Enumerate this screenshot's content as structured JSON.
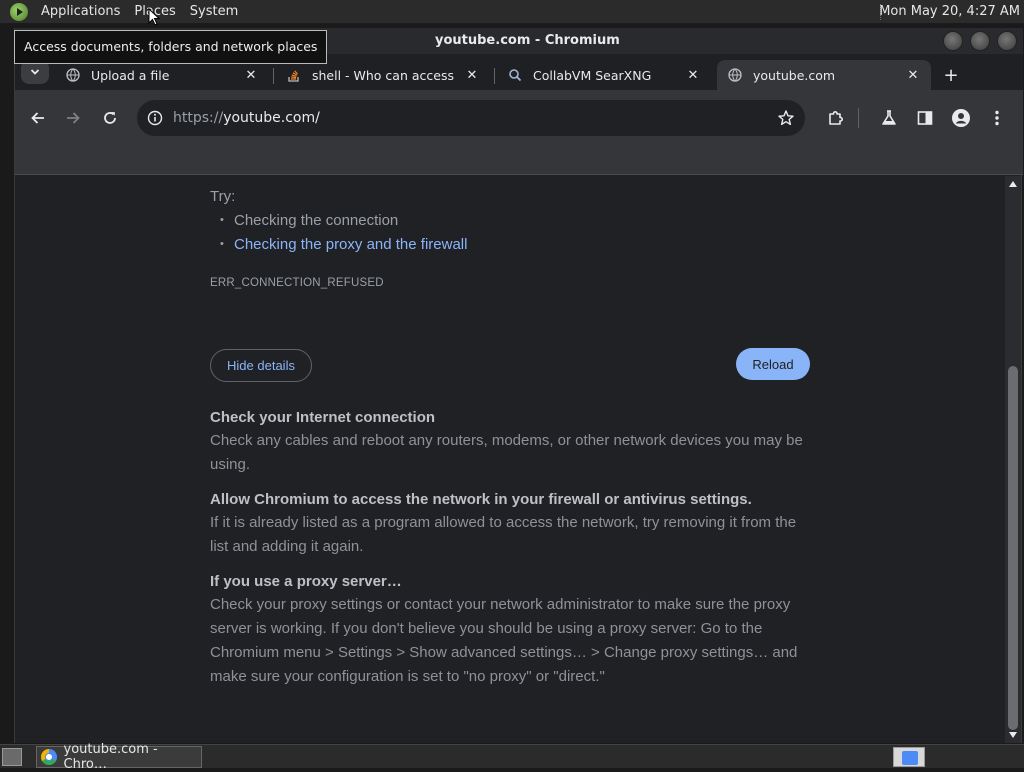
{
  "top_panel": {
    "menus": [
      "Applications",
      "Places",
      "System"
    ],
    "clock": "Mon May 20,  4:27 AM"
  },
  "tooltip": "Access documents, folders and network places",
  "window": {
    "title": "youtube.com - Chromium"
  },
  "tabs": [
    {
      "label": "Upload a file",
      "favicon": "globe-icon"
    },
    {
      "label": "shell - Who can access a f",
      "favicon": "stack-overflow-icon"
    },
    {
      "label": "CollabVM SearXNG",
      "favicon": "searxng-icon"
    },
    {
      "label": "youtube.com",
      "favicon": "globe-icon",
      "active": true
    }
  ],
  "toolbar": {
    "url_scheme": "https://",
    "url_host": "youtube.com/"
  },
  "error_page": {
    "try_label": "Try:",
    "suggestions": [
      "Checking the connection",
      "Checking the proxy and the firewall"
    ],
    "error_code": "ERR_CONNECTION_REFUSED",
    "hide_details_label": "Hide details",
    "reload_label": "Reload",
    "sections": [
      {
        "title": "Check your Internet connection",
        "body": "Check any cables and reboot any routers, modems, or other network devices you may be using."
      },
      {
        "title": "Allow Chromium to access the network in your firewall or antivirus settings.",
        "body": "If it is already listed as a program allowed to access the network, try removing it from the list and adding it again."
      },
      {
        "title": "If you use a proxy server…",
        "body": "Check your proxy settings or contact your network administrator to make sure the proxy server is working. If you don't believe you should be using a proxy server: Go to the Chromium menu > Settings > Show advanced settings… > Change proxy settings… and make sure your configuration is set to \"no proxy\" or \"direct.\""
      }
    ]
  },
  "taskbar": {
    "window_button_label": "youtube.com - Chro…"
  },
  "colors": {
    "link": "#8ab4f8",
    "page_bg": "#202124",
    "toolbar_bg": "#35363a"
  }
}
